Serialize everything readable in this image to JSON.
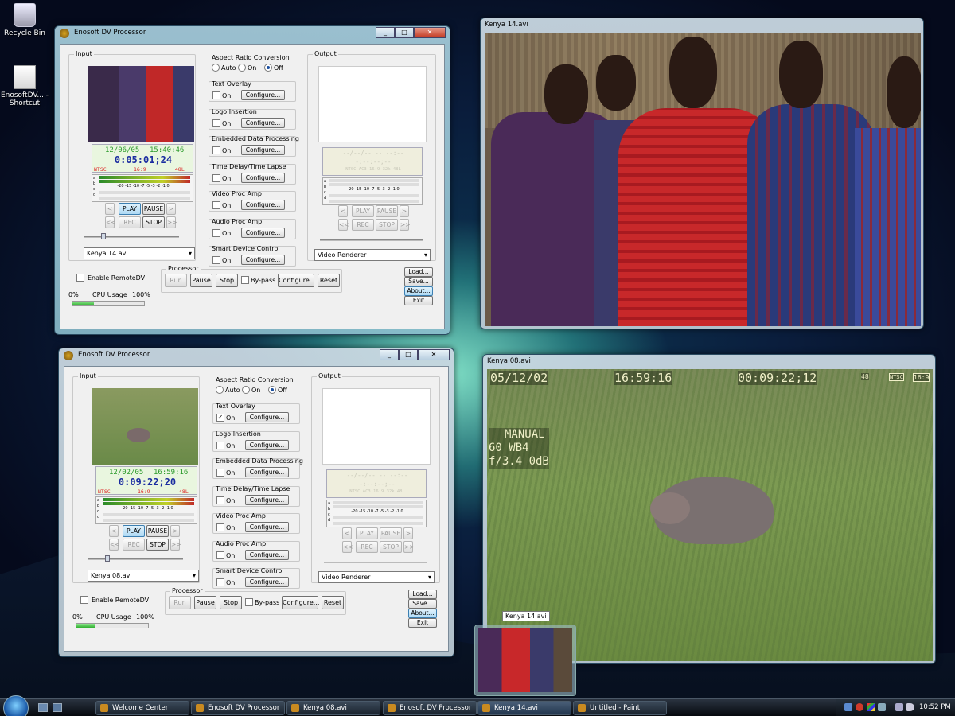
{
  "desktop": {
    "icons": [
      {
        "label": "Recycle Bin",
        "icon": "recycle-bin-icon"
      },
      {
        "label": "EnosoftDV... - Shortcut",
        "icon": "shortcut-folder-icon"
      }
    ]
  },
  "proc": [
    {
      "title": "Enosoft DV Processor",
      "input_label": "Input",
      "output_label": "Output",
      "aspect": {
        "label": "Aspect Ratio Conversion",
        "options": [
          "Auto",
          "On",
          "Off"
        ],
        "selected": "Off"
      },
      "features": [
        {
          "label": "Text Overlay",
          "on": false
        },
        {
          "label": "Logo Insertion",
          "on": false
        },
        {
          "label": "Embedded Data Processing",
          "on": false
        },
        {
          "label": "Time Delay/Time Lapse",
          "on": false
        },
        {
          "label": "Video Proc Amp",
          "on": false
        },
        {
          "label": "Audio Proc Amp",
          "on": false
        },
        {
          "label": "Smart Device Control",
          "on": false
        }
      ],
      "on_label": "On",
      "configure_label": "Configure...",
      "lcd": {
        "date": "12/06/05",
        "time": "15:40:46",
        "timecode": "0:05:01;24",
        "status": [
          "NTSC",
          "16:9",
          "48L"
        ]
      },
      "vu_scale": "-20 -15 -10 -7 -5 -3 -2 -1 0",
      "vu_channels": [
        "a",
        "b",
        "c",
        "d"
      ],
      "out_lcd": {
        "l1": "--/--/--  --:--:--",
        "l2": "-:--:--;--",
        "l3": "NTSC  AC3  16:9  32k  48L"
      },
      "transport": {
        "prev": "<",
        "play": "PLAY",
        "pause": "PAUSE",
        "next": ">",
        "rew": "<<",
        "rec": "REC",
        "stop": "STOP",
        "ff": ">>"
      },
      "input_file": "Kenya 14.avi",
      "output_device": "Video Renderer",
      "remote": "Enable RemoteDV",
      "processor_label": "Processor",
      "proc_buttons": {
        "run": "Run",
        "pause": "Pause",
        "stop": "Stop",
        "bypass": "By-pass",
        "configure": "Configure...",
        "reset": "Reset"
      },
      "cpu": {
        "min": "0%",
        "label": "CPU Usage",
        "max": "100%",
        "level": 0.3
      },
      "side": {
        "load": "Load...",
        "save": "Save...",
        "about": "About...",
        "exit": "Exit"
      }
    },
    {
      "title": "Enosoft DV Processor",
      "input_label": "Input",
      "output_label": "Output",
      "aspect": {
        "label": "Aspect Ratio Conversion",
        "options": [
          "Auto",
          "On",
          "Off"
        ],
        "selected": "Off"
      },
      "features": [
        {
          "label": "Text Overlay",
          "on": true
        },
        {
          "label": "Logo Insertion",
          "on": false
        },
        {
          "label": "Embedded Data Processing",
          "on": false
        },
        {
          "label": "Time Delay/Time Lapse",
          "on": false
        },
        {
          "label": "Video Proc Amp",
          "on": false
        },
        {
          "label": "Audio Proc Amp",
          "on": false
        },
        {
          "label": "Smart Device Control",
          "on": false
        }
      ],
      "on_label": "On",
      "configure_label": "Configure...",
      "lcd": {
        "date": "12/02/05",
        "time": "16:59:16",
        "timecode": "0:09:22;20",
        "status": [
          "NTSC",
          "16:9",
          "48L"
        ]
      },
      "vu_scale": "-20 -15 -10 -7 -5 -3 -2 -1 0",
      "vu_channels": [
        "a",
        "b",
        "c",
        "d"
      ],
      "out_lcd": {
        "l1": "--/--/--  --:--:--",
        "l2": "-:--:--;--",
        "l3": "NTSC  AC3  16:9  32k  48L"
      },
      "transport": {
        "prev": "<",
        "play": "PLAY",
        "pause": "PAUSE",
        "next": ">",
        "rew": "<<",
        "rec": "REC",
        "stop": "STOP",
        "ff": ">>"
      },
      "input_file": "Kenya 08.avi",
      "output_device": "Video Renderer",
      "remote": "Enable RemoteDV",
      "processor_label": "Processor",
      "proc_buttons": {
        "run": "Run",
        "pause": "Pause",
        "stop": "Stop",
        "bypass": "By-pass",
        "configure": "Configure...",
        "reset": "Reset"
      },
      "cpu": {
        "min": "0%",
        "label": "CPU Usage",
        "max": "100%",
        "level": 0.25
      },
      "side": {
        "load": "Load...",
        "save": "Save...",
        "about": "About...",
        "exit": "Exit"
      }
    }
  ],
  "video1": {
    "title": "Kenya 14.avi"
  },
  "video2": {
    "title": "Kenya 08.avi",
    "osd": {
      "date": "05/12/02",
      "time": "16:59:16",
      "tc": "00:09:22;12",
      "badges": [
        "48",
        "NTSC",
        "16:9"
      ],
      "manual": "MANUAL",
      "wb": "60 WB4",
      "fstop": "f/3.4 0dB"
    }
  },
  "thumbnail": {
    "tooltip": "Kenya 14.avi"
  },
  "taskbar": {
    "items": [
      "Welcome Center",
      "Enosoft DV Processor",
      "Kenya 08.avi",
      "Enosoft DV Processor",
      "Kenya 14.avi",
      "Untitled - Paint"
    ],
    "clock": "10:52 PM"
  },
  "colors": {
    "lcd_green": "#2a9a2a",
    "lcd_blue": "#1a2ca0",
    "status_red": "#d22"
  }
}
